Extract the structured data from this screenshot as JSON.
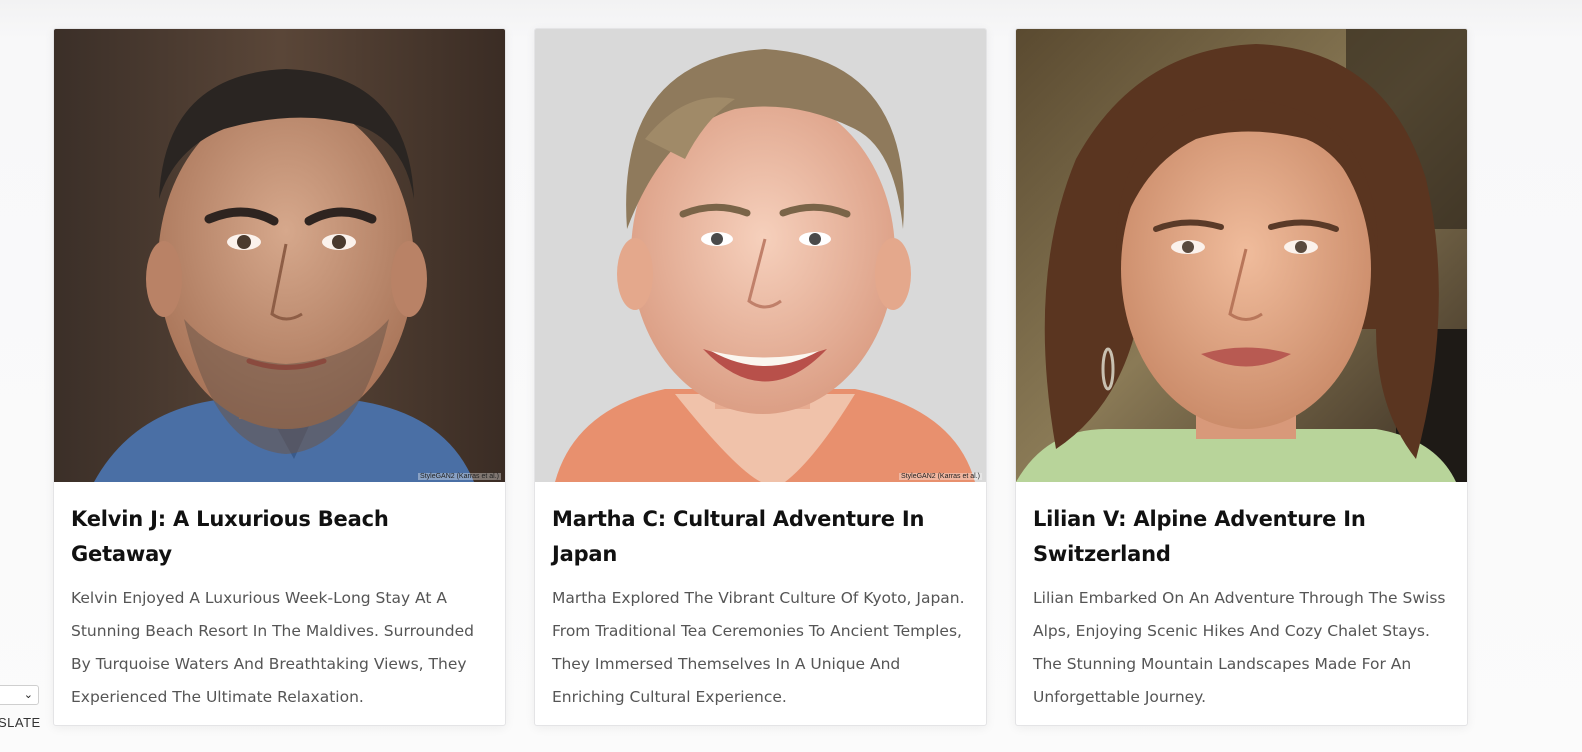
{
  "cards": [
    {
      "title": "Kelvin J: A Luxurious Beach Getaway",
      "description": "Kelvin Enjoyed A Luxurious Week-Long Stay At A Stunning Beach Resort In The Maldives. Surrounded By Turquoise Waters And Breathtaking Views, They Experienced The Ultimate Relaxation.",
      "image_credit": "StyleGAN2 (Karras et al.)",
      "photo_subject": "man with short dark hair and stubble",
      "colors": {
        "background": "#4a3a30",
        "skin": "#c89a7e",
        "hair": "#2a2522",
        "shirt": "#4a6fa5"
      }
    },
    {
      "title": "Martha C: Cultural Adventure In Japan",
      "description": "Martha Explored The Vibrant Culture Of Kyoto, Japan. From Traditional Tea Ceremonies To Ancient Temples, They Immersed Themselves In A Unique And Enriching Cultural Experience.",
      "image_credit": "StyleGAN2 (Karras et al.)",
      "photo_subject": "smiling person with short light-brown hair",
      "colors": {
        "background": "#d6d6d6",
        "skin": "#f0c2aa",
        "hair": "#8f7a5c",
        "shirt": "#e8906e"
      }
    },
    {
      "title": "Lilian V: Alpine Adventure In Switzerland",
      "description": "Lilian Embarked On An Adventure Through The Swiss Alps, Enjoying Scenic Hikes And Cozy Chalet Stays. The Stunning Mountain Landscapes Made For An Unforgettable Journey.",
      "image_credit": "",
      "photo_subject": "woman with long curly brown hair",
      "colors": {
        "background": "#7a6a48",
        "skin": "#e2a886",
        "hair": "#5a3520",
        "shirt": "#b8d49a"
      }
    }
  ],
  "translate_widget": {
    "label": "SLATE",
    "chevron_icon": "chevron-down-icon"
  }
}
